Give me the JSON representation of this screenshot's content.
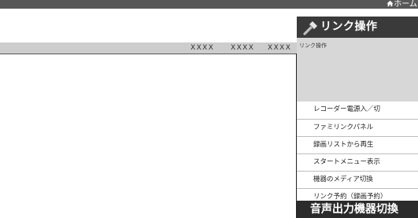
{
  "topbar": {
    "home_label": "ホーム"
  },
  "breadcrumb": {
    "items": [
      "XXXX",
      "XXXX",
      "XXXX"
    ]
  },
  "panel": {
    "title": "リンク操作",
    "sub_label": "リンク操作",
    "menu": [
      "レコーダー電源入／切",
      "ファミリンクパネル",
      "録画リストから再生",
      "スタートメニュー表示",
      "機器のメディア切換",
      "リンク予約（録画予約）"
    ],
    "footer": "音声出力機器切換"
  },
  "colors": {
    "topbar": "#575757",
    "header": "#3a3a3a",
    "footer": "#2b2b2b",
    "subbar": "#cdcdcd",
    "panel_gray": "#d7d7d7"
  }
}
